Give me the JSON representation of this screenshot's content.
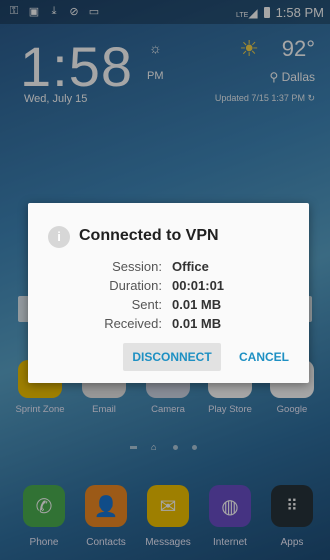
{
  "status_bar": {
    "time": "1:58 PM",
    "left_icons": [
      "vpn-key-icon",
      "flipboard-icon",
      "download-icon",
      "check-circle-icon",
      "voicemail-icon"
    ],
    "network_label": "LTE"
  },
  "clock": {
    "time": "1:58",
    "ampm": "PM",
    "date": "Wed, July 15"
  },
  "weather": {
    "temperature": "92°",
    "location": "Dallas",
    "updated": "Updated 7/15 1:37 PM"
  },
  "dialog": {
    "title": "Connected to VPN",
    "rows": [
      {
        "label": "Session:",
        "value": "Office"
      },
      {
        "label": "Duration:",
        "value": "00:01:01"
      },
      {
        "label": "Sent:",
        "value": "0.01 MB"
      },
      {
        "label": "Received:",
        "value": "0.01 MB"
      }
    ],
    "disconnect_label": "DISCONNECT",
    "cancel_label": "CANCEL"
  },
  "apps": [
    {
      "label": "Sprint Zone",
      "icon": "sprint-zone-icon",
      "color": "#f3c400"
    },
    {
      "label": "Email",
      "icon": "email-icon",
      "color": "#e9e9e9"
    },
    {
      "label": "Camera",
      "icon": "camera-icon",
      "color": "#cfd8e6"
    },
    {
      "label": "Play Store",
      "icon": "play-store-icon",
      "color": "#ffffff"
    },
    {
      "label": "Google",
      "icon": "google-icon",
      "color": "#ffffff"
    }
  ],
  "dock": [
    {
      "label": "Phone",
      "icon": "phone-icon",
      "color": "#4caf50"
    },
    {
      "label": "Contacts",
      "icon": "contacts-icon",
      "color": "#f08a24"
    },
    {
      "label": "Messages",
      "icon": "messages-icon",
      "color": "#f3c400"
    },
    {
      "label": "Internet",
      "icon": "internet-icon",
      "color": "#6a4fc8"
    },
    {
      "label": "Apps",
      "icon": "apps-grid-icon",
      "color": "#27343b"
    }
  ]
}
